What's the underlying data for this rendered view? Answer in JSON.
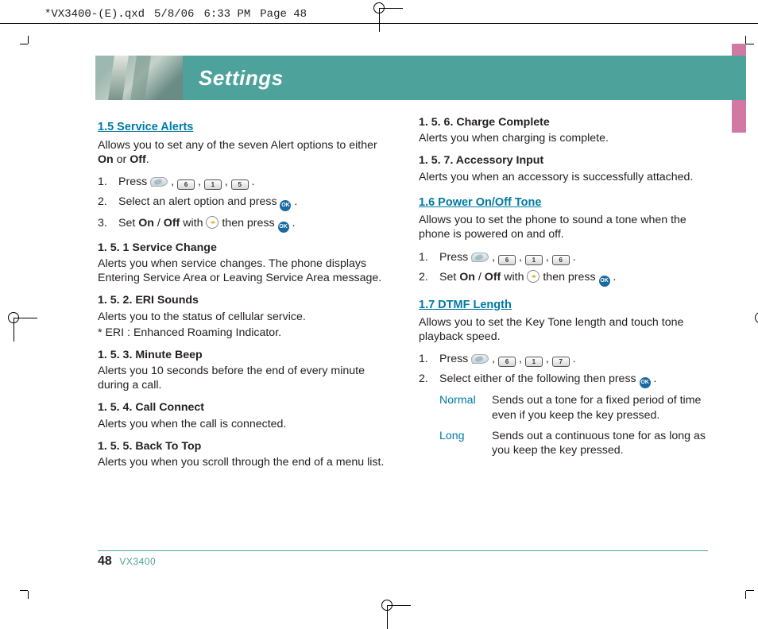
{
  "qxd": {
    "filename": "*VX3400-(E).qxd",
    "date": "5/8/06",
    "time": "6:33 PM",
    "page": "Page 48"
  },
  "header": {
    "title": "Settings"
  },
  "footer": {
    "page_number": "48",
    "model": "VX3400"
  },
  "keys": {
    "k1": "1",
    "k5": "5",
    "k6": "6",
    "k7": "7",
    "ok": "OK"
  },
  "s15": {
    "title": "1.5 Service Alerts",
    "intro_a": "Allows you to set any of the seven Alert options to either ",
    "on": "On",
    "or": " or ",
    "off": "Off",
    "period": ".",
    "step1": "Press ",
    "step2_a": "Select an alert option and press ",
    "step3_a": "Set ",
    "step3_slash": " / ",
    "step3_b": " with ",
    "step3_c": " then press ",
    "s1": {
      "title": "1. 5. 1 Service Change",
      "body": "Alerts you when service changes. The phone displays Entering Service Area or Leaving Service Area message."
    },
    "s2": {
      "title": "1. 5. 2. ERI Sounds",
      "body1": "Alerts you to the status of cellular service.",
      "body2": "* ERI : Enhanced Roaming Indicator."
    },
    "s3": {
      "title": "1. 5. 3. Minute Beep",
      "body": "Alerts you 10 seconds before the end of every minute during a call."
    },
    "s4": {
      "title": "1. 5. 4. Call Connect",
      "body": "Alerts you when the call is connected."
    },
    "s5": {
      "title": "1. 5. 5. Back To Top",
      "body": "Alerts you when you scroll through the end of a menu list."
    },
    "s6": {
      "title": "1. 5. 6. Charge Complete",
      "body": "Alerts you when charging is complete."
    },
    "s7": {
      "title": "1. 5. 7. Accessory Input",
      "body": "Alerts you when an accessory is successfully attached."
    }
  },
  "s16": {
    "title": "1.6 Power On/Off Tone",
    "intro": "Allows you to set the phone to sound a tone when the phone is powered on and off.",
    "step1": "Press ",
    "step2_a": "Set ",
    "on": "On",
    "slash": " / ",
    "off": "Off",
    "step2_b": " with ",
    "step2_c": " then press "
  },
  "s17": {
    "title": "1.7 DTMF Length",
    "intro": "Allows you to set the Key Tone length and touch tone playback speed.",
    "step1": "Press ",
    "step2": "Select either of the following then press ",
    "normal_label": "Normal",
    "normal_desc": "Sends out a tone for a fixed period of time even if you keep the key pressed.",
    "long_label": "Long",
    "long_desc": "Sends out a continuous tone for as long as you keep the key pressed."
  },
  "nums": {
    "n1": "1.",
    "n2": "2.",
    "n3": "3."
  },
  "comma": " , ",
  "dot": " ."
}
